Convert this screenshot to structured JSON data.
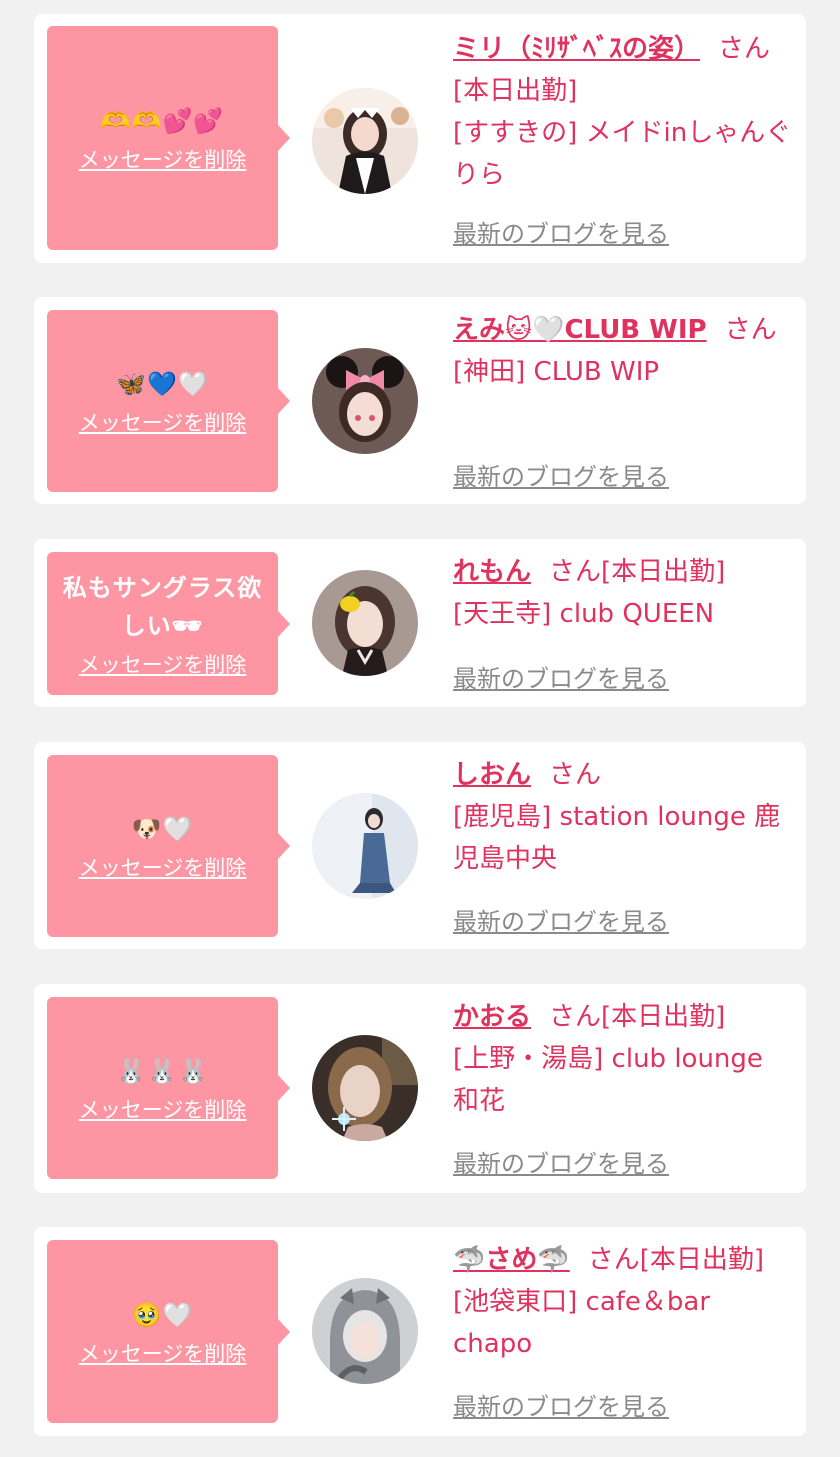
{
  "colors": {
    "background": "#f1f1f1",
    "card": "#ffffff",
    "bubble": "#fd96a2",
    "accent": "#e0325f",
    "muted": "#8a8a8a"
  },
  "items": [
    {
      "message": "🫶🫶💕💕",
      "delete_label": "メッセージを削除",
      "name": "ミリ（ﾐﾘｻﾞﾍﾞｽの姿）",
      "suffix": "さん[本日出勤]",
      "shop": "[すすきの] メイドinしゃんぐりら",
      "blog_label": "最新のブログを見る",
      "avatar_icon": "maid-portrait"
    },
    {
      "message": "🦋💙🤍",
      "delete_label": "メッセージを削除",
      "name": "えみ🐱🤍CLUB WIP",
      "suffix": "さん",
      "shop": "[神田] CLUB WIP",
      "blog_label": "最新のブログを見る",
      "avatar_icon": "mouse-ears-portrait"
    },
    {
      "message": "私もサングラス欲しい🕶",
      "delete_label": "メッセージを削除",
      "name": "れもん",
      "suffix": "さん[本日出勤]",
      "shop": "[天王寺] club QUEEN",
      "blog_label": "最新のブログを見る",
      "avatar_icon": "lemon-portrait"
    },
    {
      "message": "🐶🤍",
      "delete_label": "メッセージを削除",
      "name": "しおん",
      "suffix": "さん",
      "shop": "[鹿児島] station lounge 鹿児島中央",
      "blog_label": "最新のブログを見る",
      "avatar_icon": "dress-portrait"
    },
    {
      "message": "🐰🐰🐰",
      "delete_label": "メッセージを削除",
      "name": "かおる",
      "suffix": "さん[本日出勤]",
      "shop": "[上野・湯島] club lounge 和花",
      "blog_label": "最新のブログを見る",
      "avatar_icon": "night-portrait"
    },
    {
      "message": "🥹🤍",
      "delete_label": "メッセージを削除",
      "name": "🦈さめ🦈",
      "suffix": "さん[本日出勤]",
      "shop": "[池袋東口] cafe＆bar chapo",
      "blog_label": "最新のブログを見る",
      "avatar_icon": "shark-hood-portrait"
    }
  ]
}
